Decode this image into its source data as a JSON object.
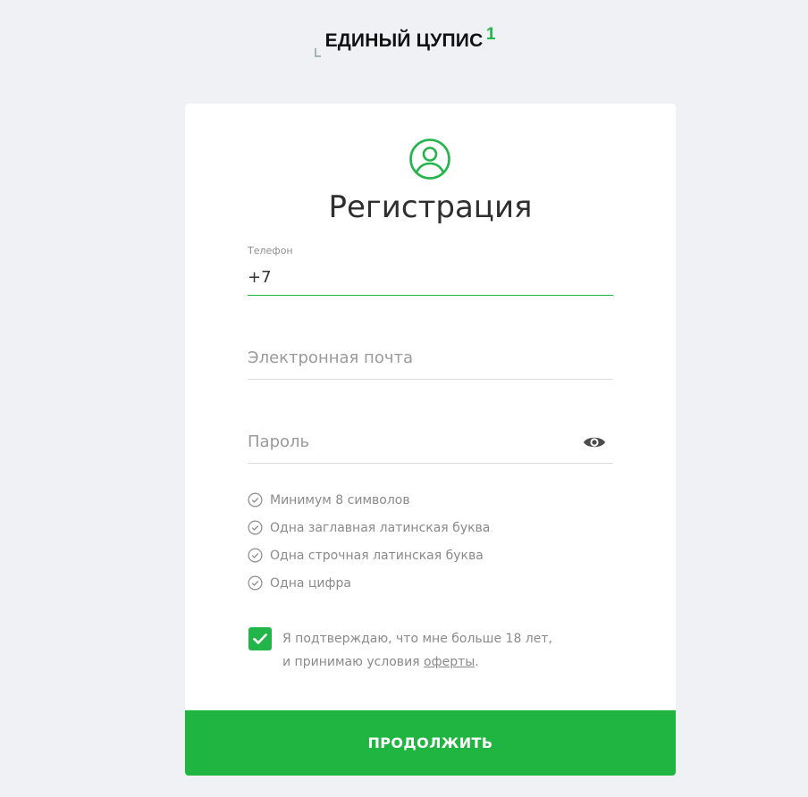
{
  "logo": {
    "text": "ЕДИНЫЙ ЦУПИС",
    "superscript": "1"
  },
  "form": {
    "title": "Регистрация",
    "icon": "user-circle-icon",
    "phone": {
      "label": "Телефон",
      "value": "+7"
    },
    "email": {
      "placeholder": "Электронная почта",
      "value": ""
    },
    "password": {
      "placeholder": "Пароль",
      "value": "",
      "toggle_icon": "eye-icon"
    },
    "rules": [
      "Минимум 8 символов",
      "Одна заглавная латинская буква",
      "Одна строчная латинская буква",
      "Одна цифра"
    ],
    "agreement": {
      "checked": true,
      "line1": "Я подтверждаю, что мне больше 18 лет,",
      "line2_prefix": "и принимаю условия ",
      "link": "оферты",
      "line2_suffix": "."
    },
    "continue_label": "ПРОДОЛЖИТЬ"
  },
  "colors": {
    "accent": "#21b54a",
    "button": "#1fb540",
    "background": "#eff1f4",
    "card": "#ffffff",
    "text_muted": "#8a8a8a"
  }
}
